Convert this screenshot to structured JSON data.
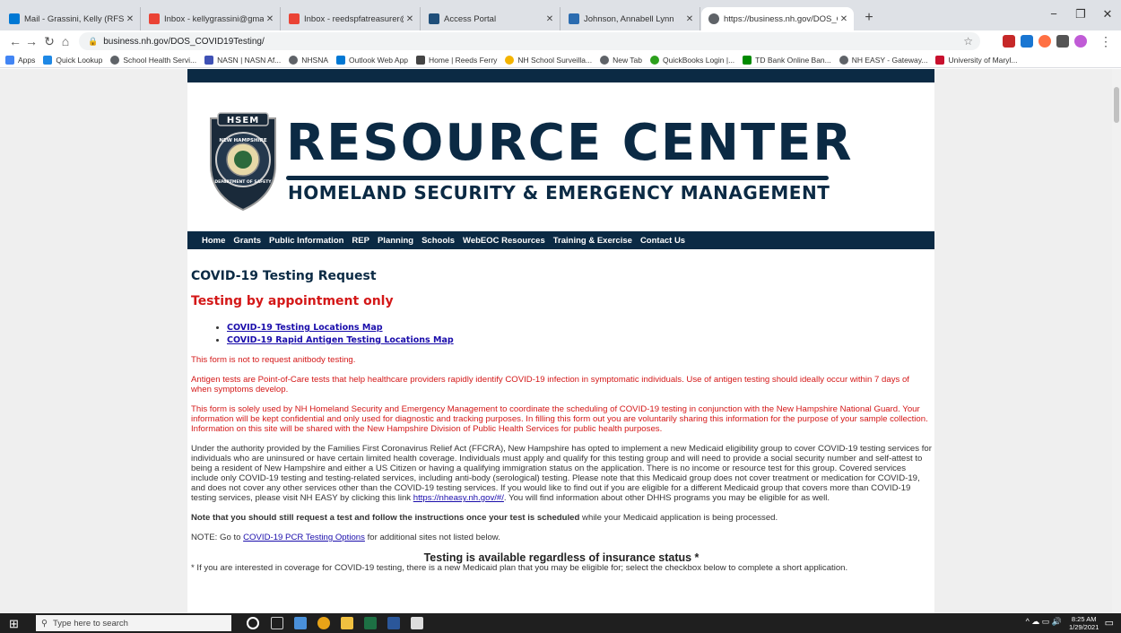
{
  "browser": {
    "tabs": [
      {
        "label": "Mail - Grassini, Kelly (RFS) - Outl",
        "color": "#0078d4"
      },
      {
        "label": "Inbox - kellygrassini@gmail.com",
        "color": "#ea4335"
      },
      {
        "label": "Inbox - reedspfatreasurer@gmail",
        "color": "#ea4335"
      },
      {
        "label": "Access Portal",
        "color": "#1f4e79"
      },
      {
        "label": "Johnson, Annabell Lynn",
        "color": "#2b6cb0"
      },
      {
        "label": "https://business.nh.gov/DOS_CO",
        "color": "#5f6368"
      }
    ],
    "new_tab": "+",
    "window_controls": {
      "minimize": "−",
      "restore": "❐",
      "close": "✕"
    },
    "url": "business.nh.gov/DOS_COVID19Testing/",
    "bookmarks": [
      {
        "label": "Apps",
        "color": "#4285f4"
      },
      {
        "label": "Quick Lookup",
        "color": "#1e88e5"
      },
      {
        "label": "School Health Servi...",
        "color": "#5f6368"
      },
      {
        "label": "NASN | NASN Af...",
        "color": "#3f51b5"
      },
      {
        "label": "NHSNA",
        "color": "#5f6368"
      },
      {
        "label": "Outlook Web App",
        "color": "#0078d4"
      },
      {
        "label": "Home | Reeds Ferry",
        "color": "#444"
      },
      {
        "label": "NH School Surveilla...",
        "color": "#f4b400"
      },
      {
        "label": "New Tab",
        "color": "#5f6368"
      },
      {
        "label": "QuickBooks Login |...",
        "color": "#2ca01c"
      },
      {
        "label": "TD Bank Online Ban...",
        "color": "#008a00"
      },
      {
        "label": "NH EASY - Gateway...",
        "color": "#5f6368"
      },
      {
        "label": "University of Maryl...",
        "color": "#c8102e"
      }
    ]
  },
  "header": {
    "seal_top": "HSEM",
    "seal_ring": "NEW HAMPSHIRE",
    "seal_bottom": "DEPARTMENT OF SAFETY",
    "title": "RESOURCE CENTER",
    "subtitle": "HOMELAND SECURITY & EMERGENCY MANAGEMENT"
  },
  "nav": [
    "Home",
    "Grants",
    "Public Information",
    "REP",
    "Planning",
    "Schools",
    "WebEOC Resources",
    "Training & Exercise",
    "Contact Us"
  ],
  "content": {
    "title": "COVID-19 Testing Request",
    "subtitle": "Testing by appointment only",
    "links": [
      "COVID-19 Testing Locations Map",
      "COVID-19 Rapid Antigen Testing Locations Map"
    ],
    "red_p1": "This form is not to request anitbody testing.",
    "red_p2": "Antigen tests are Point-of-Care tests that help healthcare providers rapidly identify COVID-19 infection in symptomatic individuals. Use of antigen testing should ideally occur within 7 days of when symptoms develop.",
    "red_p3": "This form is solely used by NH Homeland Security and Emergency Management to coordinate the scheduling of COVID-19 testing in conjunction with the New Hampshire National Guard. Your information will be kept confidential and only used for diagnostic and tracking purposes. In filling this form out you are voluntarily sharing this information for the purpose of your sample collection. Information on this site will be shared with the New Hampshire Division of Public Health Services for public health purposes.",
    "ffcra_p": "Under the authority provided by the Families First Coronavirus Relief Act (FFCRA), New Hampshire has opted to implement a new Medicaid eligibility group to cover COVID-19 testing services for individuals who are uninsured or have certain limited health coverage. Individuals must apply and qualify for this testing group and will need to provide a social security number and self-attest to being a resident of New Hampshire and either a US Citizen or having a qualifying immigration status on the application. There is no income or resource test for this group. Covered services include only COVID-19 testing and testing-related services, including anti-body (serological) testing. Please note that this Medicaid group does not cover treatment or medication for COVID-19, and does not cover any other services other than the COVID-19 testing services. If you would like to find out if you are eligible for a different Medicaid group that covers more than COVID-19 testing services, please visit NH EASY by clicking this link",
    "ffcra_link": "https://nheasy.nh.gov/#/",
    "ffcra_tail": ". You will find information about other DHHS programs you may be eligible for as well.",
    "note_bold": "Note that you should still request a test and follow the instructions once your test is scheduled",
    "note_rest": " while your Medicaid application is being processed.",
    "note2_prefix": "NOTE: Go to ",
    "note2_link": "COVID-19 PCR Testing Options",
    "note2_suffix": " for additional sites not listed below.",
    "insurance_heading": "Testing is available regardless of insurance status *",
    "insurance_p": "* If you are interested in coverage for COVID-19 testing, there is a new Medicaid plan that you may be eligible for; select the checkbox below to complete a short application."
  },
  "taskbar": {
    "search_placeholder": "Type here to search",
    "time": "8:25 AM",
    "date": "1/29/2021"
  }
}
